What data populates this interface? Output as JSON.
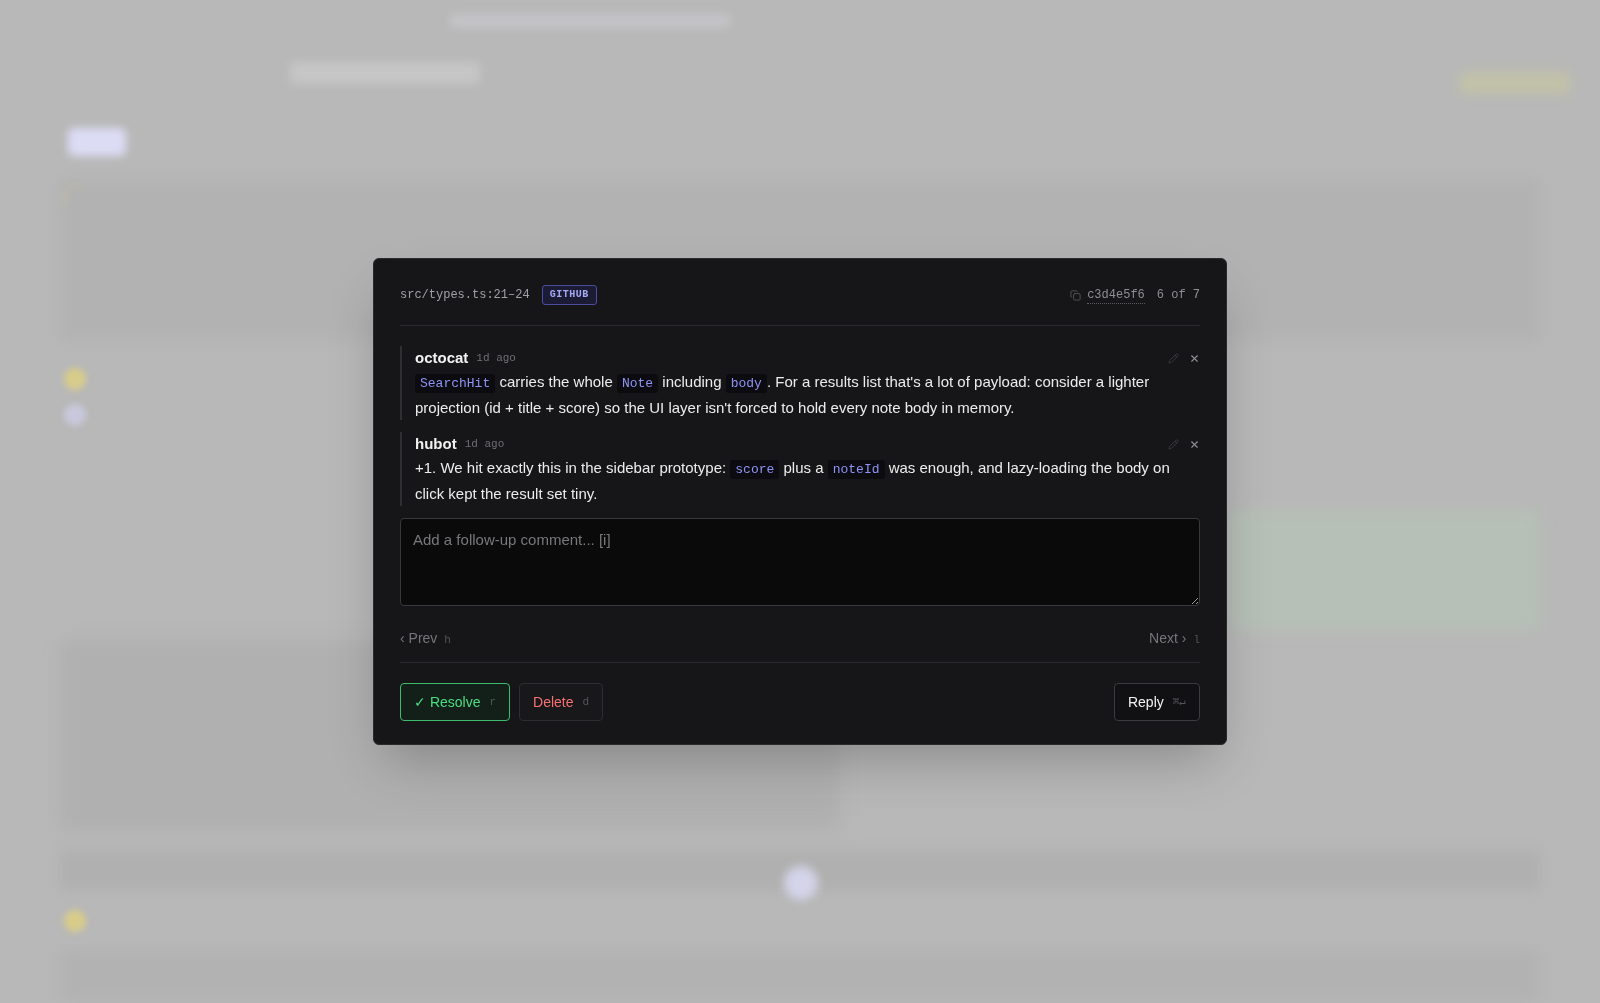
{
  "dialog": {
    "location": "src/types.ts:21–24",
    "source_badge": "GITHUB",
    "commit": "c3d4e5f6",
    "position": "6 of 7",
    "comments": [
      {
        "author": "octocat",
        "time": "1d ago",
        "body": [
          {
            "kind": "code",
            "text": "SearchHit"
          },
          {
            "kind": "text",
            "text": " carries the whole "
          },
          {
            "kind": "code",
            "text": "Note"
          },
          {
            "kind": "text",
            "text": " including "
          },
          {
            "kind": "code",
            "text": "body"
          },
          {
            "kind": "text",
            "text": ". For a results list that's a lot of payload: consider a lighter projection (id + title + score) so the UI layer isn't forced to hold every note body in memory."
          }
        ]
      },
      {
        "author": "hubot",
        "time": "1d ago",
        "body": [
          {
            "kind": "text",
            "text": "+1. We hit exactly this in the sidebar prototype: "
          },
          {
            "kind": "code",
            "text": "score"
          },
          {
            "kind": "text",
            "text": " plus a "
          },
          {
            "kind": "code",
            "text": "noteId"
          },
          {
            "kind": "text",
            "text": " was enough, and lazy-loading the body on click kept the result set tiny."
          }
        ]
      }
    ],
    "reply_field": {
      "placeholder": "Add a follow-up comment... [i]"
    },
    "nav": [
      {
        "kind": "prev",
        "label": "‹ Prev",
        "shortcut": "h"
      },
      {
        "kind": "next",
        "label": "Next ›",
        "shortcut": "l"
      }
    ],
    "actions": [
      {
        "kind": "resolve",
        "label": "✓ Resolve",
        "shortcut": "r"
      },
      {
        "kind": "delete",
        "label": "Delete",
        "shortcut": "d"
      },
      {
        "kind": "reply",
        "label": "Reply",
        "shortcut": "⌘↵"
      }
    ]
  }
}
